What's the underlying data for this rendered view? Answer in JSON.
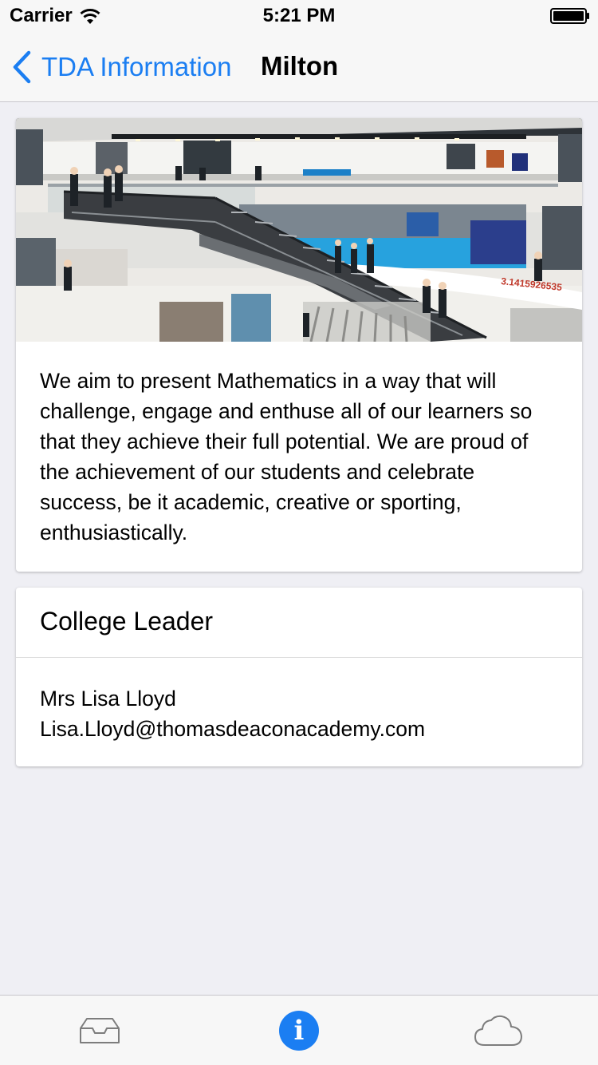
{
  "status_bar": {
    "carrier": "Carrier",
    "time": "5:21 PM"
  },
  "nav": {
    "back_label": "TDA Information",
    "title": "Milton"
  },
  "hero": {
    "wall_text": "3.1415926535"
  },
  "intro": {
    "text": "We aim to present Mathematics in a way that will challenge, engage and enthuse all of our learners so that they achieve their full potential. We are proud of the achievement of our students and celebrate success, be it academic, creative or sporting, enthusiastically."
  },
  "leader": {
    "heading": "College Leader",
    "name": "Mrs Lisa Lloyd",
    "email": "Lisa.Lloyd@thomasdeaconacademy.com"
  },
  "tab_bar": {
    "tabs": [
      {
        "icon": "inbox-icon"
      },
      {
        "icon": "info-icon",
        "glyph": "i",
        "active": true
      },
      {
        "icon": "cloud-icon"
      }
    ]
  },
  "colors": {
    "accent": "#1b7ef2",
    "background": "#efeff4",
    "bar": "#f7f7f7"
  }
}
